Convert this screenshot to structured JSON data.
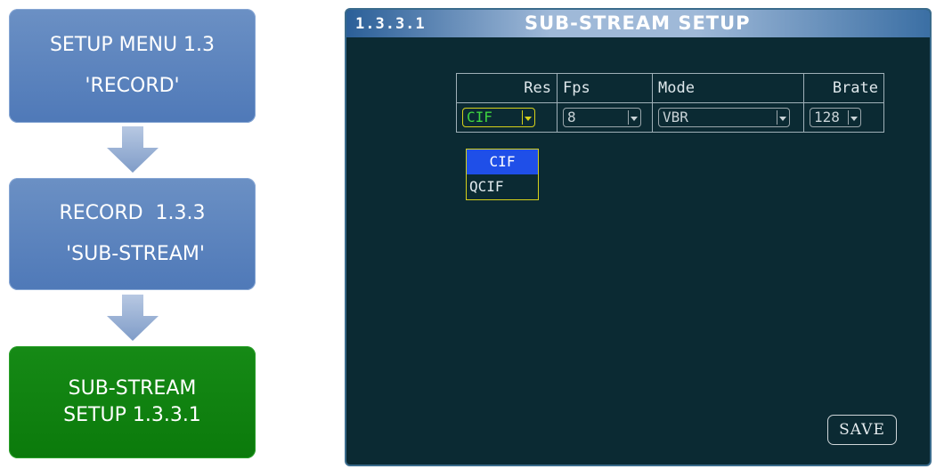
{
  "flow": {
    "steps": [
      {
        "line1": "SETUP MENU 1.3",
        "line2": "'RECORD'"
      },
      {
        "line1": "RECORD  1.3.3",
        "line2": " 'SUB-STREAM'"
      },
      {
        "line1": "SUB-STREAM",
        "line2": "SETUP 1.3.3.1"
      }
    ],
    "colors": {
      "blue": "#5680bd",
      "green": "#107e10",
      "arrow": "#8fa8cc"
    }
  },
  "screen": {
    "menu_number": "1.3.3.1",
    "title": "SUB-STREAM SETUP",
    "table": {
      "headers": [
        "Res",
        "Fps",
        "Mode",
        "Brate"
      ],
      "values": {
        "res": "CIF",
        "fps": "8",
        "mode": "VBR",
        "brate": "128"
      }
    },
    "res_dropdown": {
      "options": [
        "CIF",
        "QCIF"
      ],
      "highlighted": "CIF"
    },
    "save_label": "SAVE",
    "colors": {
      "background": "#0b2a33",
      "focus": "#d7d11a",
      "selected_text": "#3fd43f",
      "highlight": "#1f4fe8"
    }
  }
}
